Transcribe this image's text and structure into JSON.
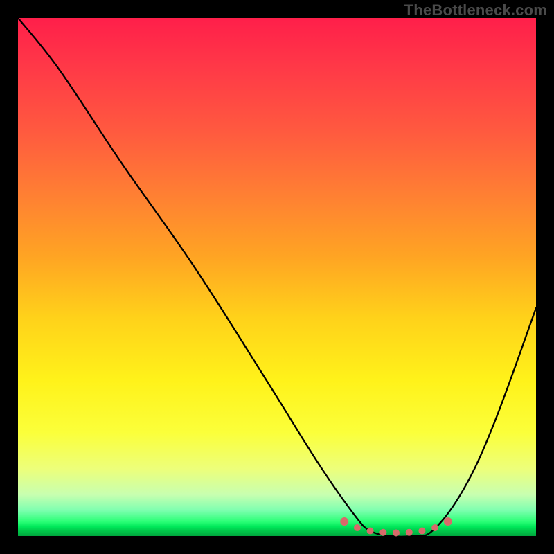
{
  "watermark": "TheBottleneck.com",
  "chart_data": {
    "type": "line",
    "title": "",
    "xlabel": "",
    "ylabel": "",
    "xlim": [
      0,
      100
    ],
    "ylim": [
      0,
      100
    ],
    "grid": false,
    "legend": false,
    "series": [
      {
        "name": "bottleneck-curve",
        "x": [
          0,
          8,
          20,
          34,
          48,
          58,
          65,
          68,
          72,
          76,
          80,
          86,
          92,
          100
        ],
        "values": [
          100,
          90,
          72,
          52,
          30,
          14,
          4,
          1,
          0,
          0,
          1,
          9,
          22,
          44
        ]
      }
    ],
    "markers": {
      "name": "optimal-range",
      "color": "#d86a6a",
      "x": [
        63,
        65.5,
        68,
        70.5,
        73,
        75.5,
        78,
        80.5,
        83
      ],
      "values": [
        2.8,
        1.6,
        1.0,
        0.7,
        0.6,
        0.7,
        1.0,
        1.6,
        2.8
      ]
    },
    "background_gradient": {
      "top": "#ff1f4a",
      "mid": "#ffd21a",
      "bottom": "#00a53d"
    }
  }
}
